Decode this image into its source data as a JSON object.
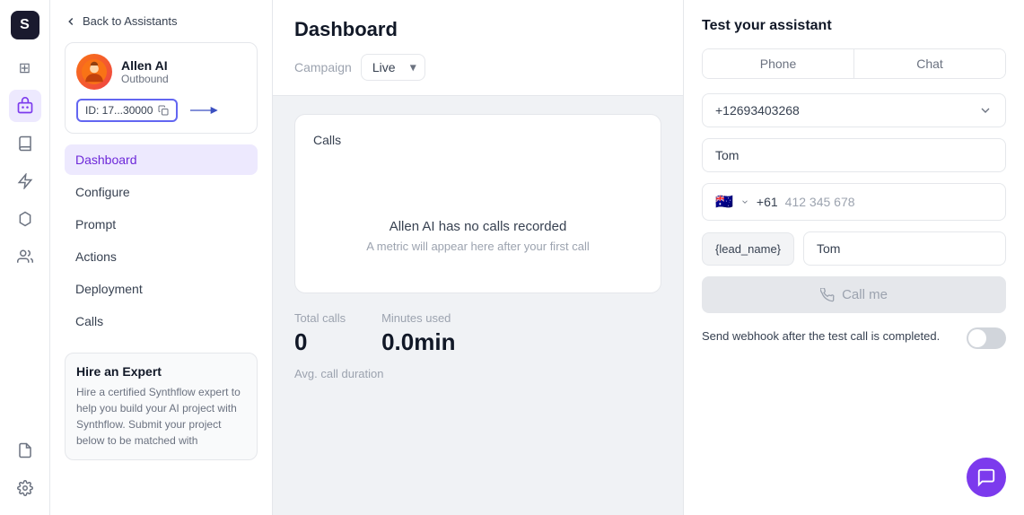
{
  "app": {
    "logo_char": "S"
  },
  "icon_bar": {
    "items": [
      {
        "name": "home-icon",
        "glyph": "⊞",
        "active": false
      },
      {
        "name": "bot-icon",
        "glyph": "🤖",
        "active": true
      },
      {
        "name": "book-icon",
        "glyph": "📖",
        "active": false
      },
      {
        "name": "lightning-icon",
        "glyph": "⚡",
        "active": false
      },
      {
        "name": "graph-icon",
        "glyph": "⬡",
        "active": false
      },
      {
        "name": "people-icon",
        "glyph": "👥",
        "active": false
      },
      {
        "name": "gear2-icon",
        "glyph": "⚙",
        "active": false
      },
      {
        "name": "receipt-icon",
        "glyph": "🧾",
        "active": false
      },
      {
        "name": "settings-icon",
        "glyph": "⚙",
        "active": false
      }
    ]
  },
  "sidebar": {
    "back_label": "Back to Assistants",
    "agent": {
      "name": "Allen AI",
      "type": "Outbound",
      "id_label": "ID: 17...30000",
      "avatar_emoji": "👨"
    },
    "nav_items": [
      {
        "label": "Dashboard",
        "active": true
      },
      {
        "label": "Configure",
        "active": false
      },
      {
        "label": "Prompt",
        "active": false
      },
      {
        "label": "Actions",
        "active": false
      },
      {
        "label": "Deployment",
        "active": false
      },
      {
        "label": "Calls",
        "active": false
      }
    ],
    "hire_expert": {
      "title": "Hire an Expert",
      "description": "Hire a certified Synthflow expert to help you build your AI project with Synthflow. Submit your project below to be matched with"
    }
  },
  "dashboard": {
    "title": "Dashboard",
    "filter_label": "Campaign",
    "filter_value": "Live",
    "calls_section": {
      "label": "Calls",
      "empty_title": "Allen AI has no calls recorded",
      "empty_subtitle": "A metric will appear here after your first call"
    },
    "stats": {
      "total_calls_label": "Total calls",
      "total_calls_value": "0",
      "minutes_used_label": "Minutes used",
      "minutes_used_value": "0.0min",
      "avg_duration_label": "Avg. call duration"
    }
  },
  "right_panel": {
    "title": "Test your assistant",
    "tabs": [
      {
        "label": "Phone",
        "active": true
      },
      {
        "label": "Chat",
        "active": false
      }
    ],
    "phone_number": "+12693403268",
    "name_input": "Tom",
    "phone_flag": "🇦🇺",
    "phone_country_code": "+61",
    "phone_placeholder": "412 345 678",
    "lead_label": "{lead_name}",
    "lead_value": "Tom",
    "call_btn_label": "Call me",
    "webhook_text": "Send webhook after the test call is completed.",
    "toggle_state": false
  }
}
